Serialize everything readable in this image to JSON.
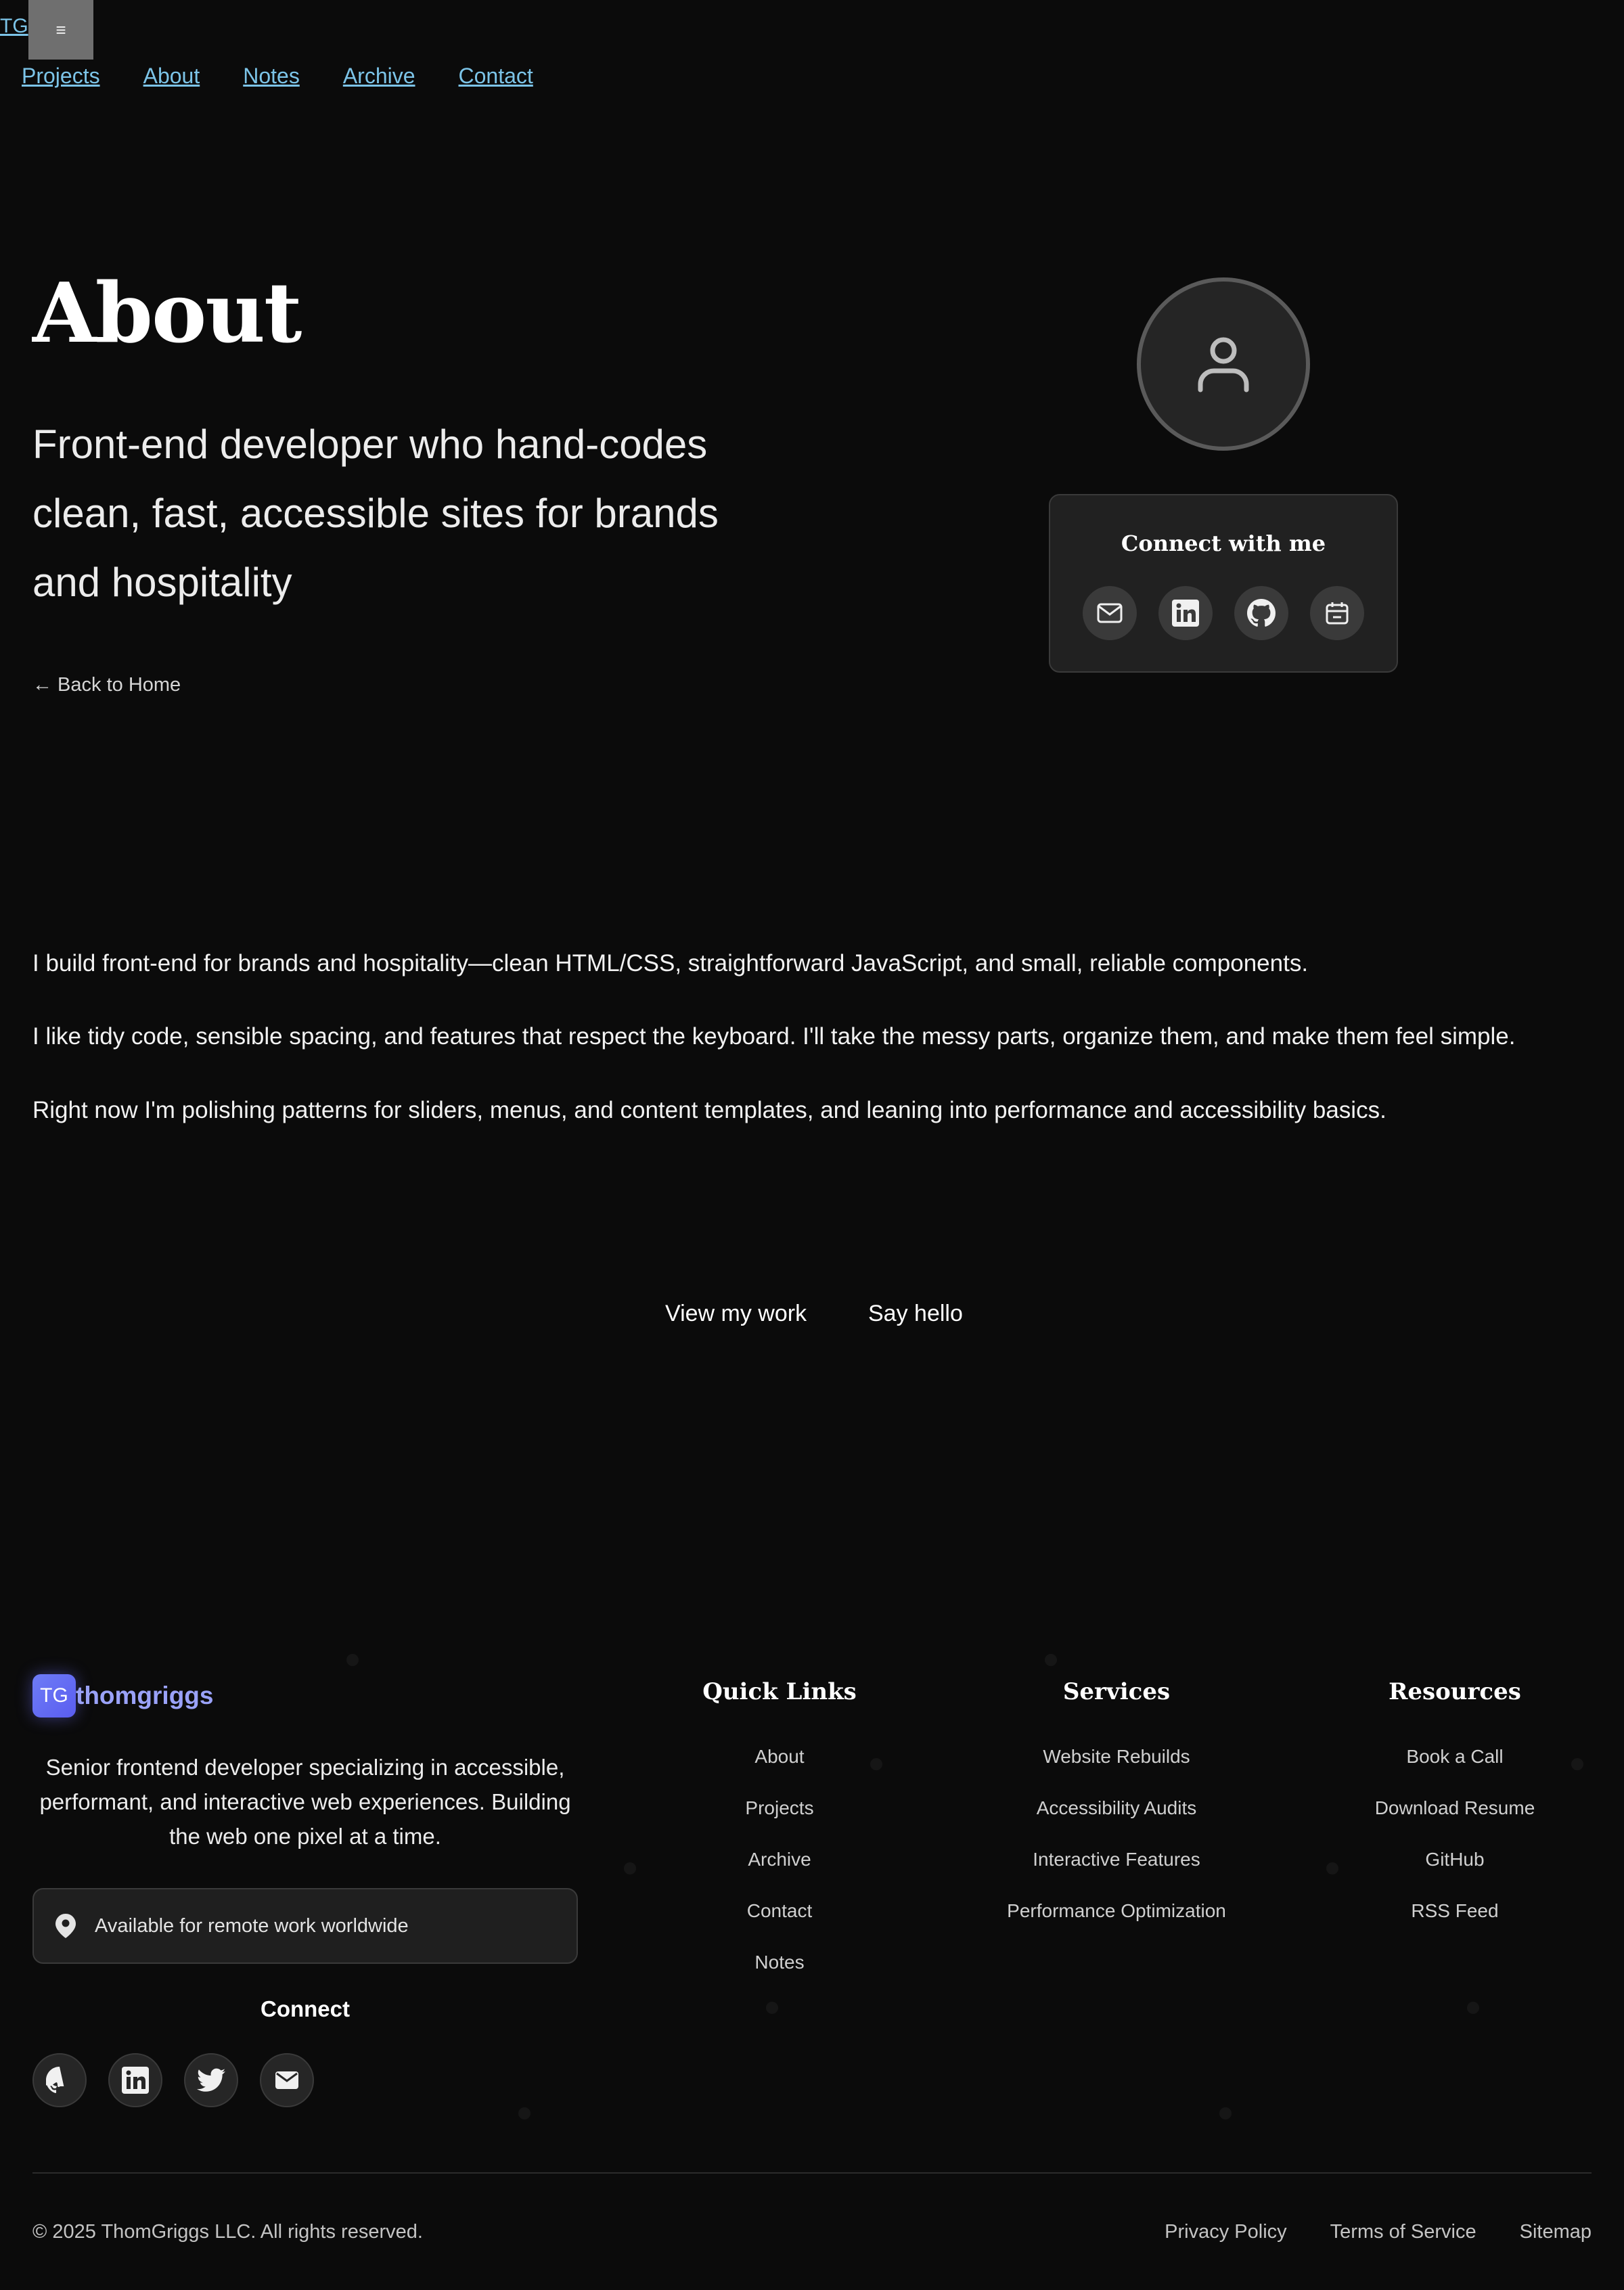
{
  "header": {
    "logo_text": "TG",
    "menu_icon": "≡",
    "nav": [
      "Projects",
      "About",
      "Notes",
      "Archive",
      "Contact"
    ]
  },
  "hero": {
    "title": "About",
    "tagline": "Front-end developer who hand-codes clean, fast, accessible sites for brands and hospitality",
    "back_link": "← Back to Home"
  },
  "connect_card": {
    "title": "Connect with me",
    "icons": [
      "mail-icon",
      "linkedin-icon",
      "github-icon",
      "calendar-icon"
    ]
  },
  "about_paragraphs": [
    "I build front-end for brands and hospitality—clean HTML/CSS, straightforward JavaScript, and small, reliable components.",
    "I like tidy code, sensible spacing, and features that respect the keyboard. I'll take the messy parts, organize them, and make them feel simple.",
    "Right now I'm polishing patterns for sliders, menus, and content templates, and leaning into performance and accessibility basics."
  ],
  "cta": {
    "primary": "View my work",
    "secondary": "Say hello"
  },
  "footer": {
    "logo_badge": "TG",
    "logo_name": "thomgriggs",
    "description": "Senior frontend developer specializing in accessible, performant, and interactive web experiences. Building the web one pixel at a time.",
    "location": "Available for remote work worldwide",
    "connect_heading": "Connect",
    "columns": {
      "quick_links": {
        "title": "Quick Links",
        "links": [
          "About",
          "Projects",
          "Archive",
          "Contact",
          "Notes"
        ]
      },
      "services": {
        "title": "Services",
        "links": [
          "Website Rebuilds",
          "Accessibility Audits",
          "Interactive Features",
          "Performance Optimization"
        ]
      },
      "resources": {
        "title": "Resources",
        "links": [
          "Book a Call",
          "Download Resume",
          "GitHub",
          "RSS Feed"
        ]
      }
    },
    "copyright": "© 2025 ThomGriggs LLC. All rights reserved.",
    "legal": [
      "Privacy Policy",
      "Terms of Service",
      "Sitemap"
    ]
  },
  "colors": {
    "background": "#0b0b0b",
    "nav_link": "#7cc4e8",
    "brand": "#6e7cf6"
  }
}
